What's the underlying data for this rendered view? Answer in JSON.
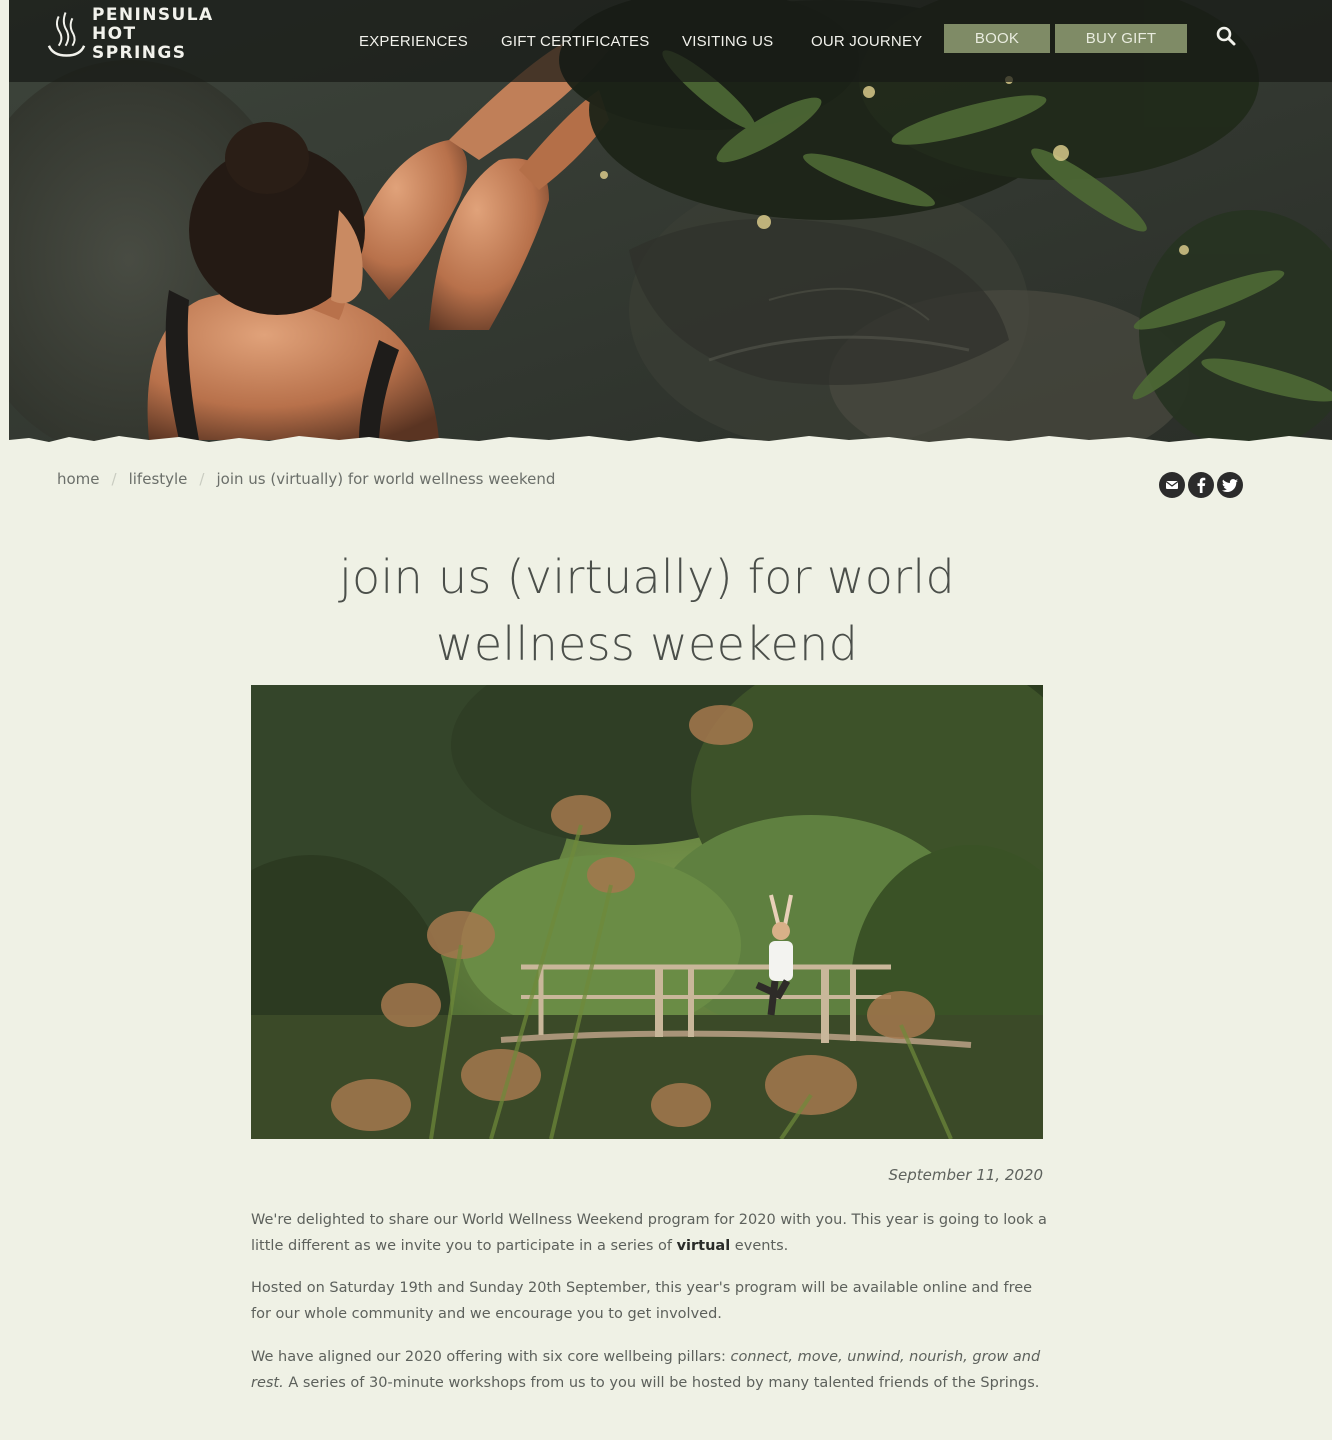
{
  "logo": {
    "line1": "PENINSULA",
    "line2": "HOT SPRINGS",
    "icon": "steam-bowl-logo-icon"
  },
  "nav": {
    "links": [
      "EXPERIENCES",
      "GIFT CERTIFICATES",
      "VISITING US",
      "OUR JOURNEY"
    ],
    "book_label": "BOOK",
    "buy_gift_label": "BUY GIFT",
    "search_icon": "search-icon"
  },
  "breadcrumb": {
    "items": [
      "home",
      "lifestyle",
      "join us (virtually) for world wellness weekend"
    ],
    "separator": "/"
  },
  "share": {
    "icons": [
      "email-icon",
      "facebook-icon",
      "twitter-icon"
    ]
  },
  "article": {
    "title": "join us (virtually) for world wellness weekend",
    "date": "September 11, 2020",
    "p1_a": "We're delighted to share our World Wellness Weekend program for 2020 with you.  This year is going to look a little different as we invite you to participate in a series of ",
    "p1_bold": "virtual",
    "p1_b": " events.",
    "p2": "Hosted on Saturday 19th and Sunday 20th September, this year's program will be available online and free for our whole community and we encourage you to get involved.",
    "p3_a": "We have aligned our 2020 offering with six core wellbeing pillars: ",
    "p3_italic": "connect, move, unwind, nourish, grow and rest.",
    "p3_b": " A series of 30-minute workshops from us to you will be hosted by many talented friends of the Springs."
  },
  "colors": {
    "page_bg": "#eff1e5",
    "nav_button": "#7f8b66",
    "topbar": "#181a16"
  }
}
